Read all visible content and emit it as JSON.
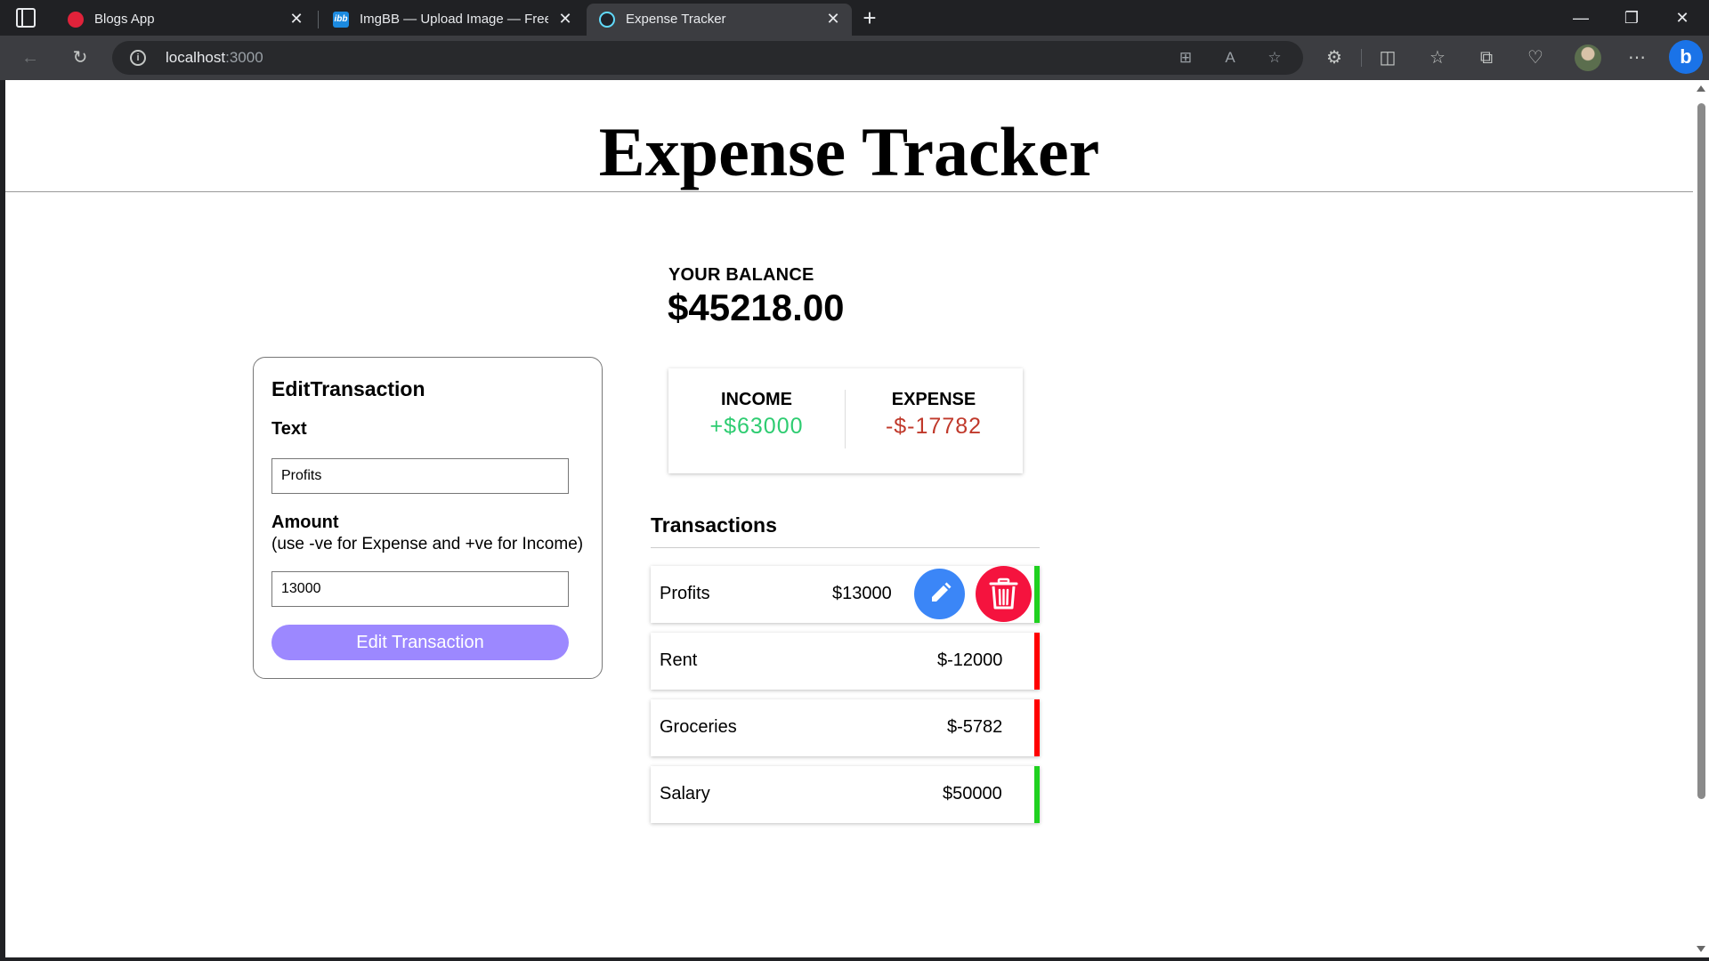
{
  "browser": {
    "tabs": [
      {
        "title": "Blogs App",
        "active": false
      },
      {
        "title": "ImgBB — Upload Image — Free",
        "active": false
      },
      {
        "title": "Expense Tracker",
        "active": true
      }
    ],
    "imgbb_favicon_text": "ibb",
    "address": {
      "host": "localhost",
      "port": ":3000"
    }
  },
  "page": {
    "title": "Expense Tracker",
    "balance": {
      "label": "YOUR BALANCE",
      "value": "$45218.00"
    },
    "edit_form": {
      "title": "EditTransaction",
      "text_label": "Text",
      "text_value": "Profits",
      "amount_label": "Amount",
      "amount_hint": "(use -ve for Expense and +ve for Income)",
      "amount_value": "13000",
      "submit_label": "Edit Transaction",
      "accent_color": "#9c88ff"
    },
    "summary": {
      "income_label": "INCOME",
      "income_value": "+$63000",
      "expense_label": "EXPENSE",
      "expense_value": "-$-17782",
      "income_color": "#2ecc71",
      "expense_color": "#c0392b"
    },
    "transactions": {
      "heading": "Transactions",
      "items": [
        {
          "text": "Profits",
          "amount": "$13000",
          "type": "plus",
          "show_actions": true
        },
        {
          "text": "Rent",
          "amount": "$-12000",
          "type": "minus",
          "show_actions": false
        },
        {
          "text": "Groceries",
          "amount": "$-5782",
          "type": "minus",
          "show_actions": false
        },
        {
          "text": "Salary",
          "amount": "$50000",
          "type": "plus",
          "show_actions": false
        }
      ]
    }
  }
}
